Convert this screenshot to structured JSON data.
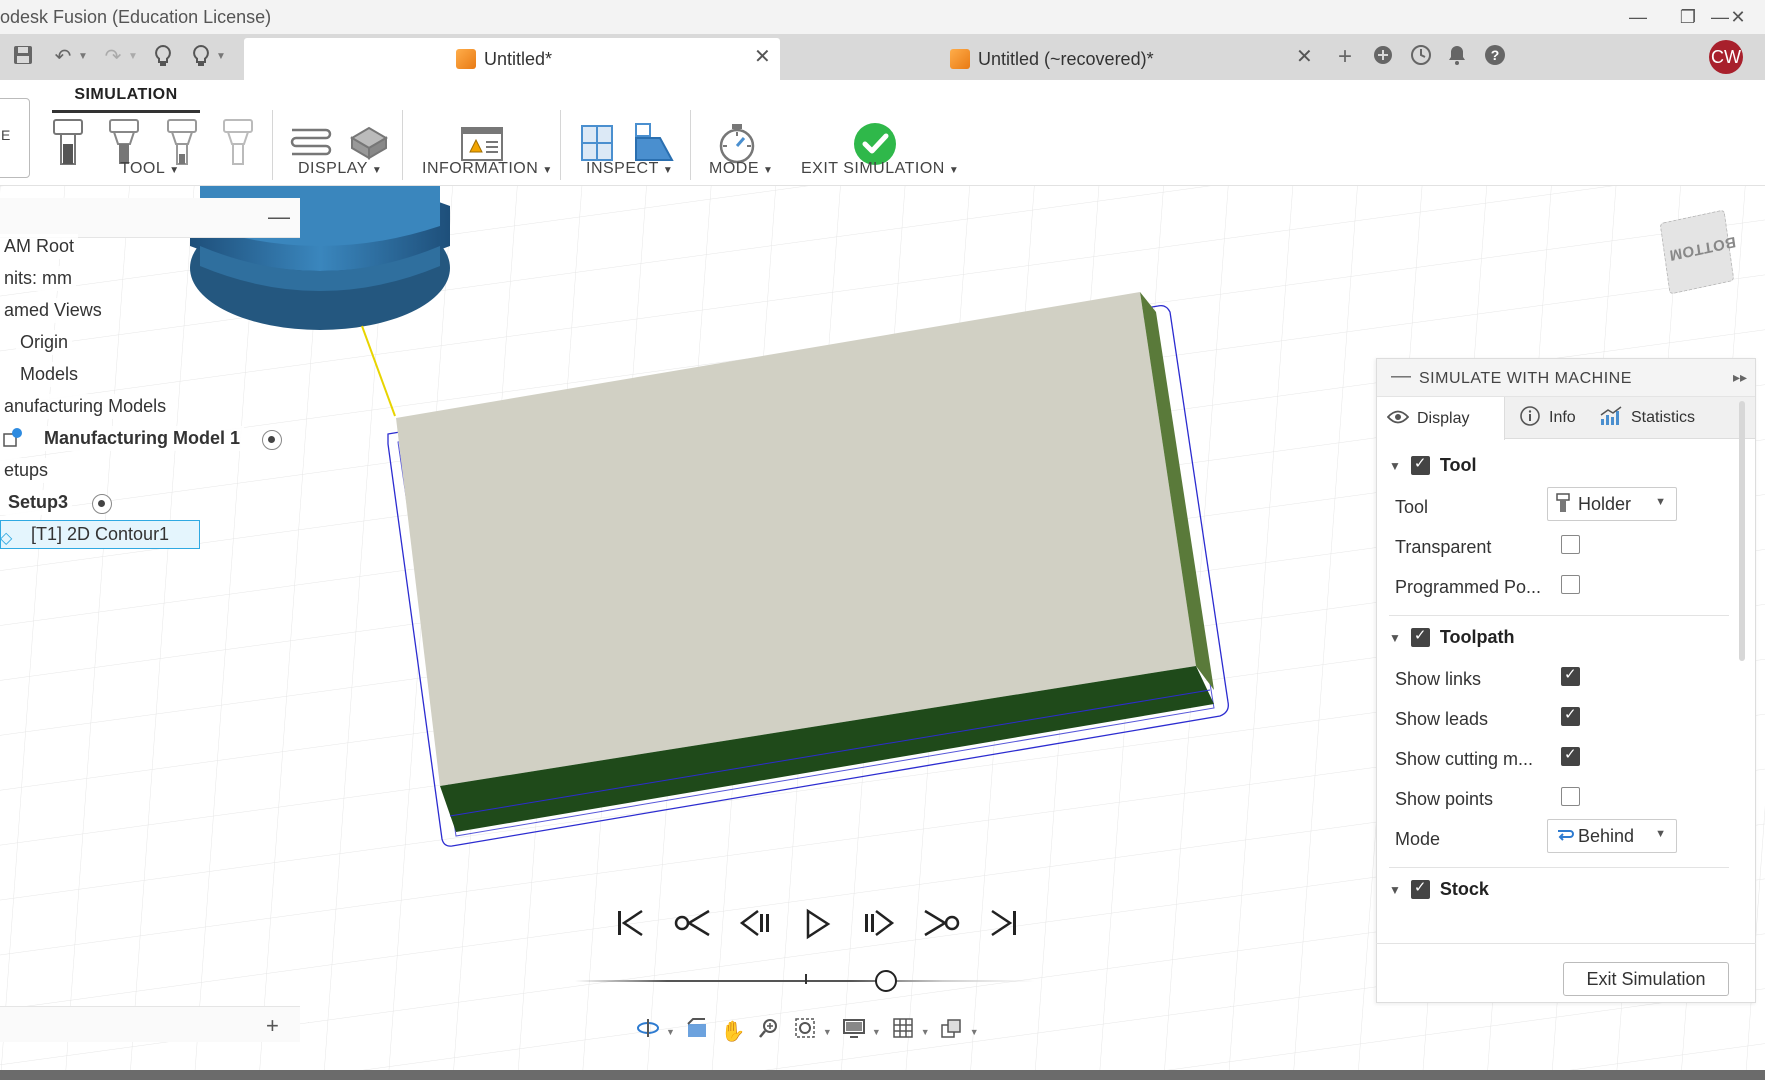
{
  "window": {
    "title": "odesk Fusion (Education License)",
    "minimize": "—",
    "restore": "❐",
    "close": "✕"
  },
  "tabs": [
    {
      "label": "Untitled*",
      "close": "✕"
    },
    {
      "label": "Untitled (~recovered)*",
      "close": "✕"
    }
  ],
  "user": {
    "initials": "CW",
    "color": "#a8202c"
  },
  "toolbar": {
    "workspace_tab": "SIMULATION",
    "workspace_switch": "E",
    "groups": {
      "tool": "TOOL",
      "display": "DISPLAY",
      "information": "INFORMATION",
      "inspect": "INSPECT",
      "mode": "MODE",
      "exit": "EXIT SIMULATION"
    }
  },
  "browser": {
    "items": {
      "cam_root": "AM Root",
      "units": "nits: mm",
      "named_views": "amed Views",
      "origin": "Origin",
      "models": "Models",
      "manufacturing_models": "anufacturing Models",
      "manufacturing_model_1": "Manufacturing Model 1",
      "setups": "etups",
      "setup3": "Setup3",
      "operation": "[T1] 2D Contour1"
    }
  },
  "viewcube": {
    "face": "BOTTOM"
  },
  "panel": {
    "title": "SIMULATE WITH MACHINE",
    "tabs": {
      "display": "Display",
      "info": "Info",
      "statistics": "Statistics"
    },
    "tool_section": {
      "title": "Tool",
      "tool_label": "Tool",
      "tool_value": "Holder",
      "transparent_label": "Transparent",
      "programmed_label": "Programmed Po..."
    },
    "toolpath_section": {
      "title": "Toolpath",
      "show_links": "Show links",
      "show_leads": "Show leads",
      "show_cutting": "Show cutting m...",
      "show_points": "Show points",
      "mode_label": "Mode",
      "mode_value": "Behind"
    },
    "stock_section": {
      "title": "Stock"
    },
    "exit_button": "Exit Simulation"
  },
  "colors": {
    "stock_top": "#d1d0c4",
    "stock_side": "#1f4a1a",
    "toolpath": "#2c2cd0",
    "tool": "#2f6f9e",
    "success": "#2fb84a"
  }
}
